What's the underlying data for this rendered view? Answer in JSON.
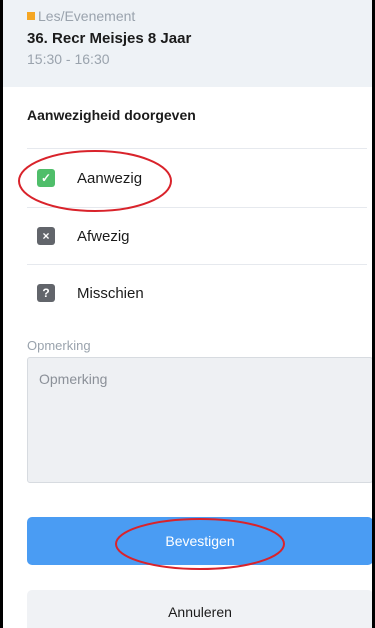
{
  "event": {
    "category": "Les/Evenement",
    "category_color": "#f5a623",
    "title": "36. Recr Meisjes 8 Jaar",
    "time": "15:30 - 16:30"
  },
  "attendance": {
    "section_title": "Aanwezigheid doorgeven",
    "options": [
      {
        "label": "Aanwezig",
        "icon": "check-icon",
        "glyph": "✓",
        "color": "#4fbe6a"
      },
      {
        "label": "Afwezig",
        "icon": "x-icon",
        "glyph": "×",
        "color": "#62656b"
      },
      {
        "label": "Misschien",
        "icon": "question-icon",
        "glyph": "?",
        "color": "#62656b"
      }
    ]
  },
  "remark": {
    "label": "Opmerking",
    "placeholder": "Opmerking",
    "value": ""
  },
  "actions": {
    "confirm_label": "Bevestigen",
    "cancel_label": "Annuleren",
    "confirm_color": "#4a9cf3"
  },
  "annotation_color": "#d9232b"
}
